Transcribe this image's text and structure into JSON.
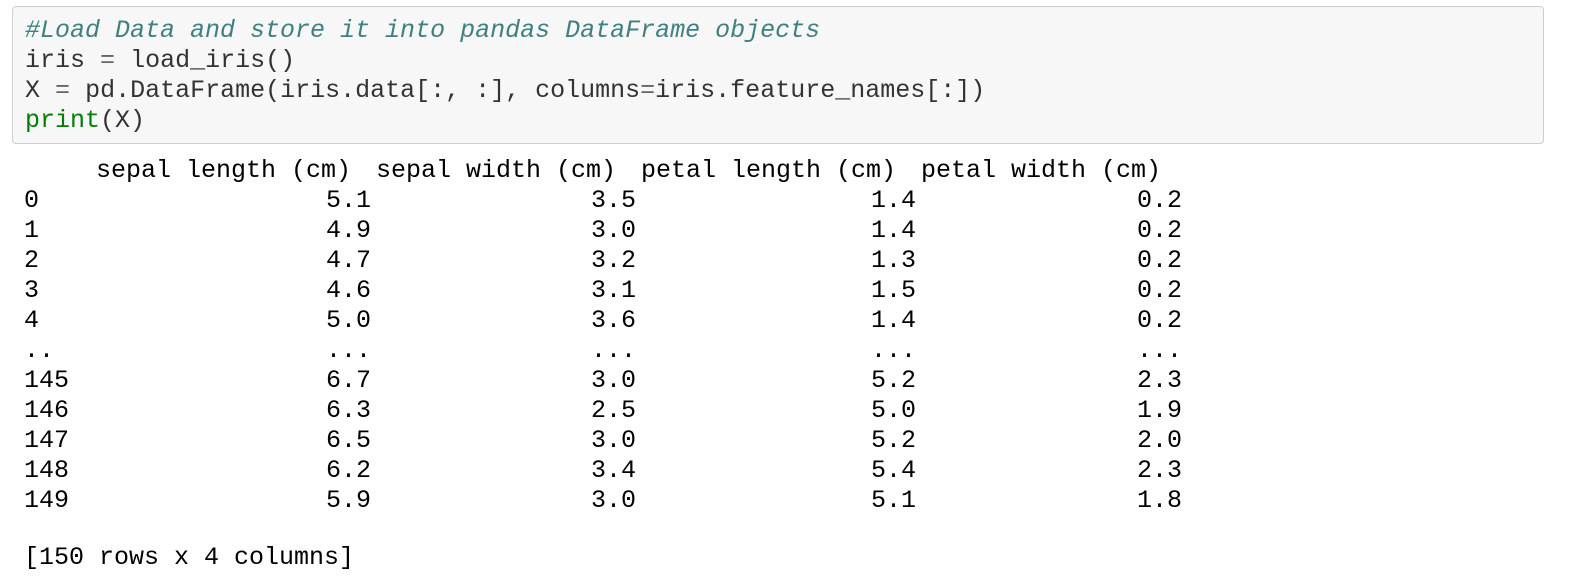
{
  "code": {
    "comment": "#Load Data and store it into pandas DataFrame objects",
    "line2_name": "iris",
    "line2_op": "=",
    "line2_call": "load_iris()",
    "line3_name": "X",
    "line3_op": "=",
    "line3_a": "pd.DataFrame(iris.data[:, :], columns",
    "line3_op2": "=",
    "line3_b": "iris.feature_names[:])",
    "line4_builtin": "print",
    "line4_args": "(X)"
  },
  "output": {
    "columns": [
      "sepal length (cm)",
      "sepal width (cm)",
      "petal length (cm)",
      "petal width (cm)"
    ],
    "rows": [
      {
        "idx": "0",
        "values": [
          "5.1",
          "3.5",
          "1.4",
          "0.2"
        ]
      },
      {
        "idx": "1",
        "values": [
          "4.9",
          "3.0",
          "1.4",
          "0.2"
        ]
      },
      {
        "idx": "2",
        "values": [
          "4.7",
          "3.2",
          "1.3",
          "0.2"
        ]
      },
      {
        "idx": "3",
        "values": [
          "4.6",
          "3.1",
          "1.5",
          "0.2"
        ]
      },
      {
        "idx": "4",
        "values": [
          "5.0",
          "3.6",
          "1.4",
          "0.2"
        ]
      },
      {
        "idx": "..",
        "values": [
          "...",
          "...",
          "...",
          "..."
        ]
      },
      {
        "idx": "145",
        "values": [
          "6.7",
          "3.0",
          "5.2",
          "2.3"
        ]
      },
      {
        "idx": "146",
        "values": [
          "6.3",
          "2.5",
          "5.0",
          "1.9"
        ]
      },
      {
        "idx": "147",
        "values": [
          "6.5",
          "3.0",
          "5.2",
          "2.0"
        ]
      },
      {
        "idx": "148",
        "values": [
          "6.2",
          "3.4",
          "5.4",
          "2.3"
        ]
      },
      {
        "idx": "149",
        "values": [
          "5.9",
          "3.0",
          "5.1",
          "1.8"
        ]
      }
    ],
    "summary": "[150 rows x 4 columns]"
  }
}
